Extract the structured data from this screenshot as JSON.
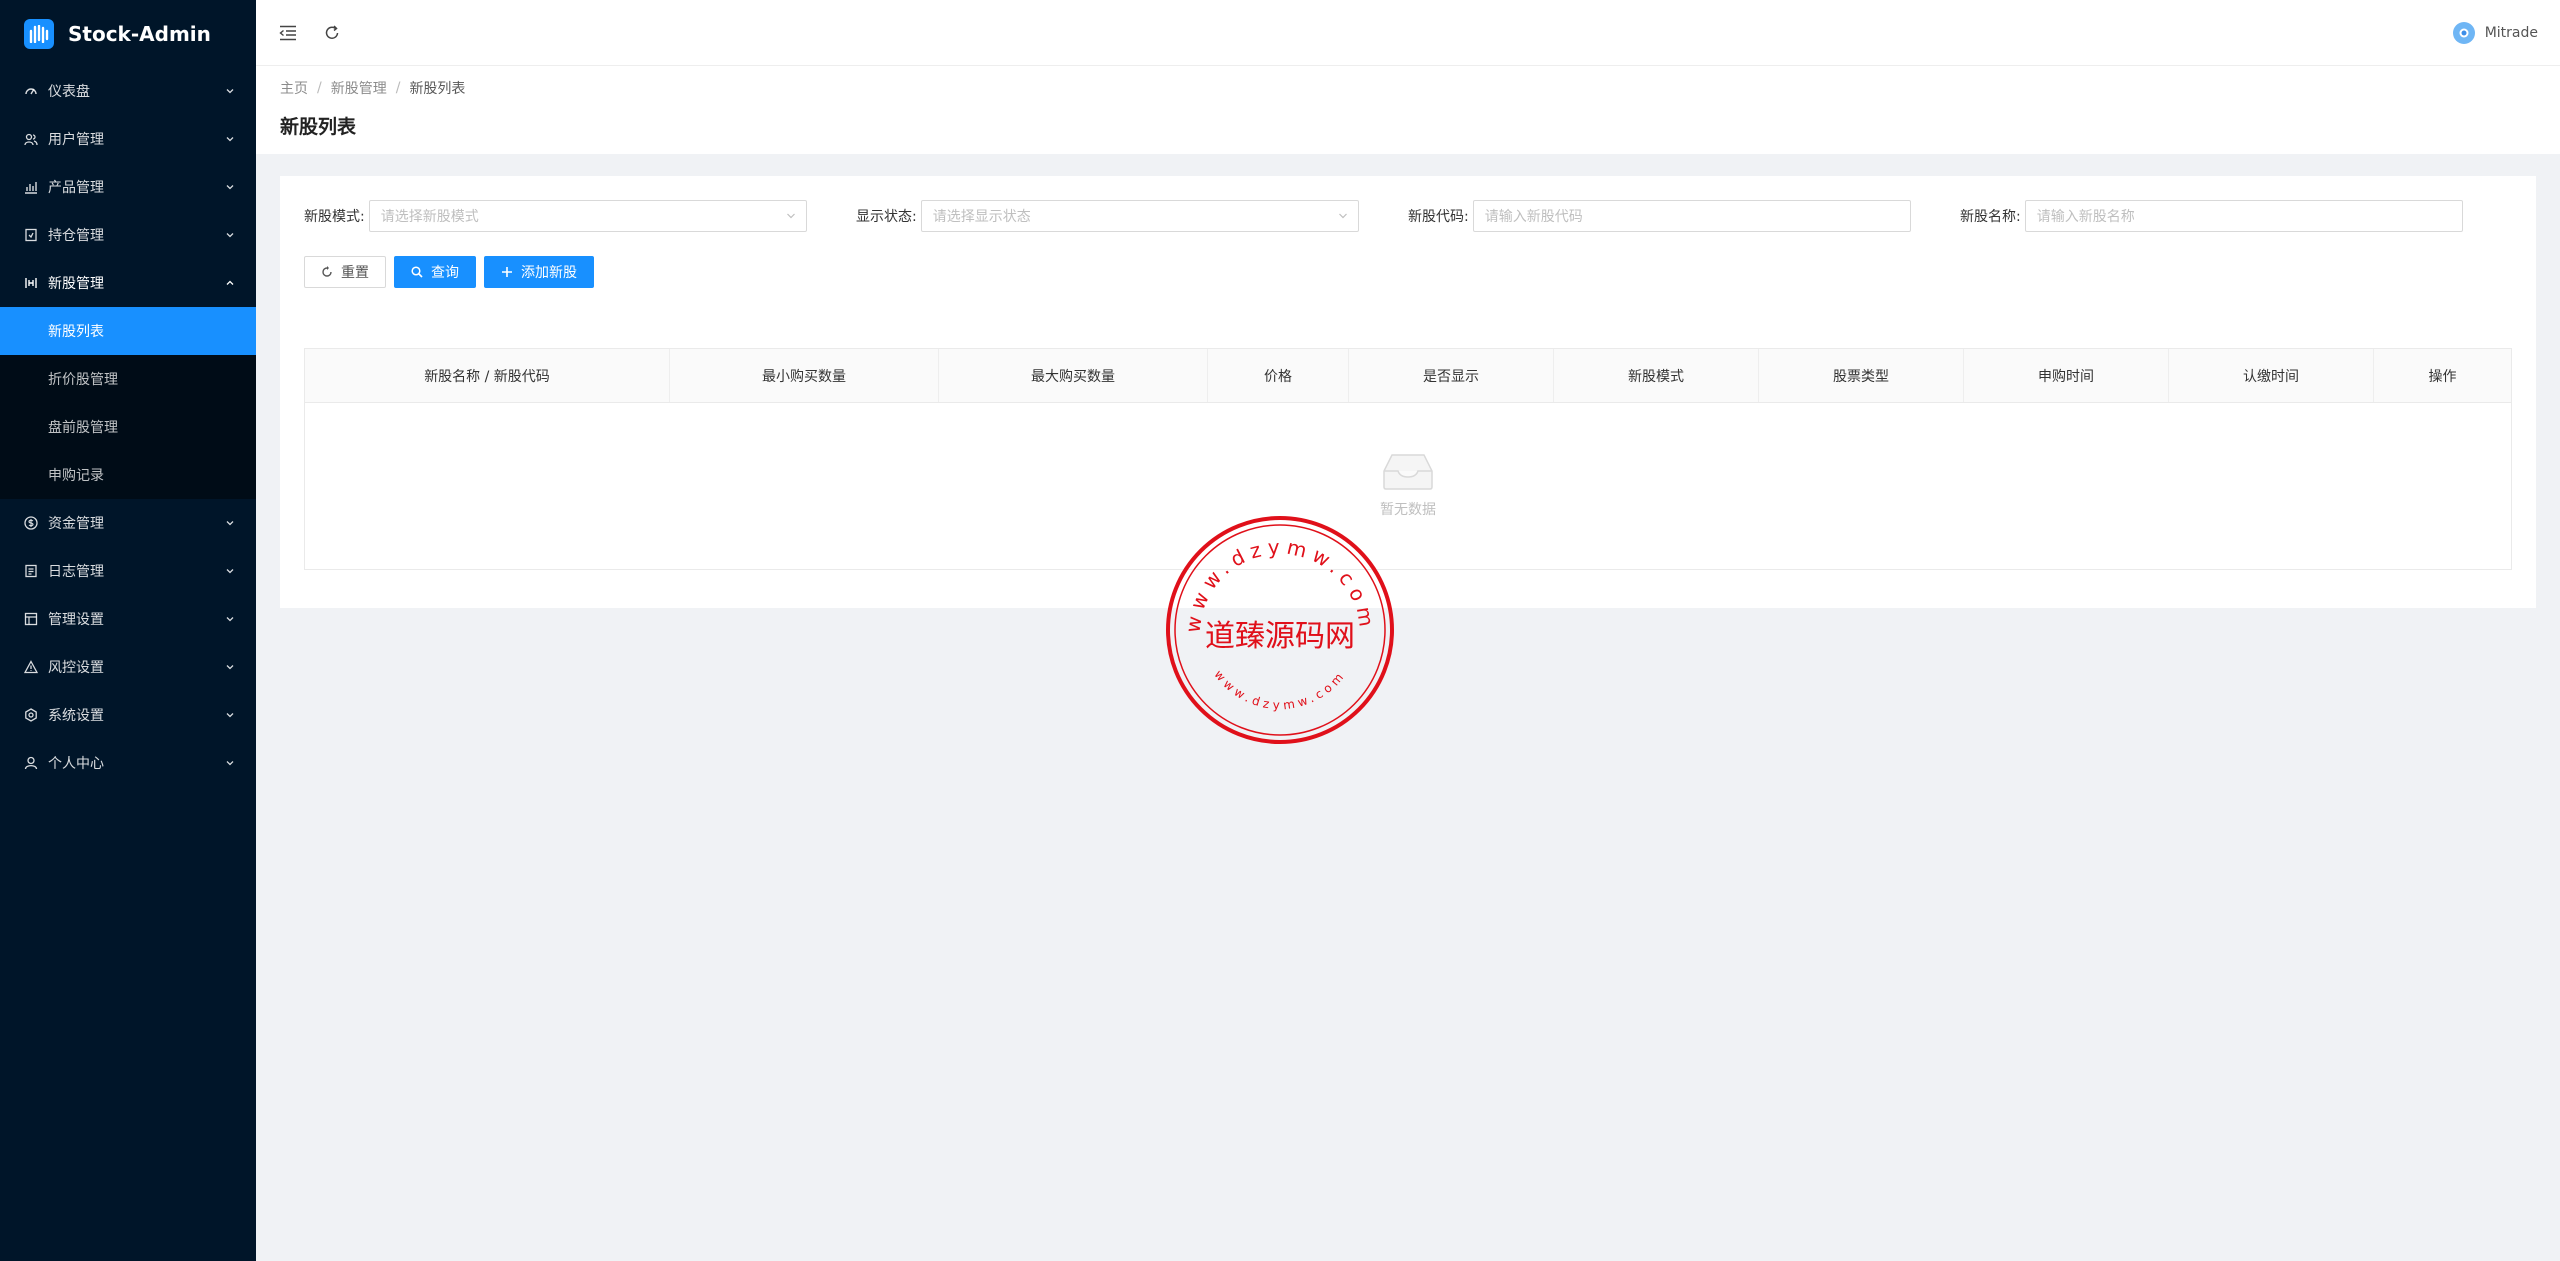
{
  "app": {
    "title": "Stock-Admin",
    "user_name": "Mitrade"
  },
  "sidebar": {
    "items": [
      {
        "label": "仪表盘",
        "icon": "dashboard-icon",
        "expanded": false
      },
      {
        "label": "用户管理",
        "icon": "users-icon",
        "expanded": false
      },
      {
        "label": "产品管理",
        "icon": "chart-icon",
        "expanded": false
      },
      {
        "label": "持仓管理",
        "icon": "holding-icon",
        "expanded": false
      },
      {
        "label": "新股管理",
        "icon": "ipo-icon",
        "expanded": true,
        "children": [
          {
            "label": "新股列表",
            "active": true
          },
          {
            "label": "折价股管理",
            "active": false
          },
          {
            "label": "盘前股管理",
            "active": false
          },
          {
            "label": "申购记录",
            "active": false
          }
        ]
      },
      {
        "label": "资金管理",
        "icon": "dollar-icon",
        "expanded": false
      },
      {
        "label": "日志管理",
        "icon": "log-icon",
        "expanded": false
      },
      {
        "label": "管理设置",
        "icon": "admin-icon",
        "expanded": false
      },
      {
        "label": "风控设置",
        "icon": "warning-icon",
        "expanded": false
      },
      {
        "label": "系统设置",
        "icon": "gear-icon",
        "expanded": false
      },
      {
        "label": "个人中心",
        "icon": "user-icon",
        "expanded": false
      }
    ]
  },
  "breadcrumb": [
    "主页",
    "新股管理",
    "新股列表"
  ],
  "page_title": "新股列表",
  "filters": {
    "mode": {
      "label": "新股模式:",
      "placeholder": "请选择新股模式"
    },
    "status": {
      "label": "显示状态:",
      "placeholder": "请选择显示状态"
    },
    "code": {
      "label": "新股代码:",
      "placeholder": "请输入新股代码"
    },
    "name": {
      "label": "新股名称:",
      "placeholder": "请输入新股名称"
    }
  },
  "buttons": {
    "reset": "重置",
    "query": "查询",
    "add": "添加新股"
  },
  "table": {
    "columns": [
      "新股名称 / 新股代码",
      "最小购买数量",
      "最大购买数量",
      "价格",
      "是否显示",
      "新股模式",
      "股票类型",
      "申购时间",
      "认缴时间",
      "操作"
    ],
    "empty_text": "暂无数据"
  },
  "stamp": {
    "title": "道臻源码网",
    "top_text": "www.dzymw.com",
    "bottom_text": "www.dzymw.com"
  },
  "colors": {
    "sidebar_bg": "#001529",
    "primary": "#1890ff",
    "stamp_red": "#e0101a"
  }
}
